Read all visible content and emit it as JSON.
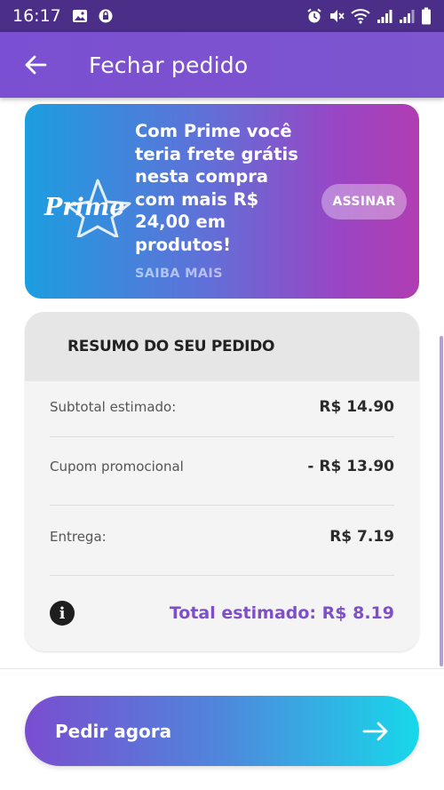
{
  "status_bar": {
    "time": "16:17",
    "icons": [
      "image-icon",
      "lock-icon",
      "alarm-icon",
      "mute-icon",
      "wifi-icon",
      "signal-icon",
      "signal-icon-2",
      "battery-icon"
    ]
  },
  "app_bar": {
    "title": "Fechar pedido",
    "back_icon": "arrow-left-icon"
  },
  "prime_banner": {
    "logo_text": "Prime",
    "message": "Com Prime você teria frete grátis nesta compra com mais R$ 24,00 em produtos!",
    "link_label": "SAIBA MAIS",
    "subscribe_label": "ASSINAR",
    "colors": {
      "start": "#1c9ee0",
      "end": "#b13db2"
    }
  },
  "summary": {
    "title": "RESUMO DO SEU PEDIDO",
    "rows": [
      {
        "label": "Subtotal estimado:",
        "value": "R$ 14.90"
      },
      {
        "label": "Cupom promocional",
        "value": "- R$ 13.90"
      },
      {
        "label": "Entrega:",
        "value": "R$ 7.19"
      }
    ],
    "total": "Total estimado: R$ 8.19",
    "accent": "#7e4fc9",
    "info_icon": "info-icon"
  },
  "order_button": {
    "label": "Pedir agora",
    "icon": "arrow-right-icon"
  }
}
